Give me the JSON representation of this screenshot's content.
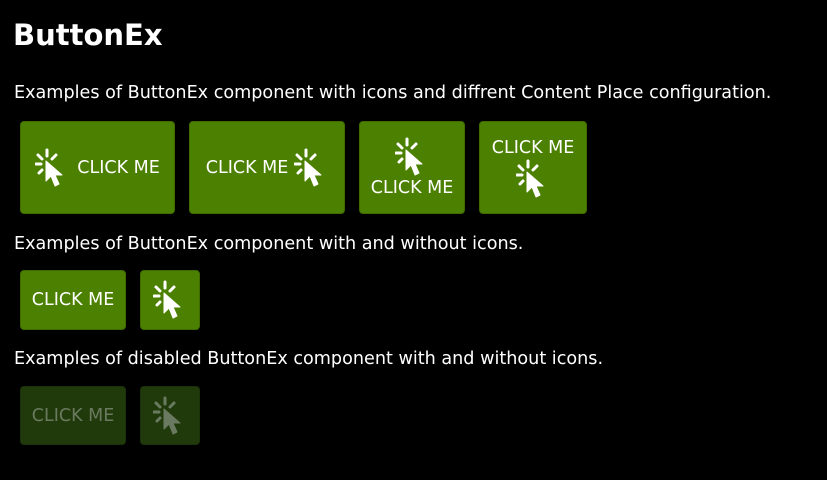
{
  "page": {
    "title": "ButtonEx",
    "desc_icons_places": "Examples of ButtonEx component with icons and diffrent Content Place configuration.",
    "desc_with_without": "Examples of ButtonEx component with and without icons.",
    "desc_disabled": "Examples of disabled ButtonEx component with and without icons."
  },
  "buttons": {
    "icon_left": {
      "label": "CLICK ME",
      "icon": "click-pointer-icon"
    },
    "icon_right": {
      "label": "CLICK ME",
      "icon": "click-pointer-icon"
    },
    "icon_top": {
      "label": "CLICK ME",
      "icon": "click-pointer-icon"
    },
    "icon_bottom": {
      "label": "CLICK ME",
      "icon": "click-pointer-icon"
    },
    "text_only": {
      "label": "CLICK ME"
    },
    "icon_only": {
      "icon": "click-pointer-icon"
    },
    "disabled_text_only": {
      "label": "CLICK ME"
    },
    "disabled_icon_only": {
      "icon": "click-pointer-icon"
    }
  },
  "colors": {
    "background": "#000000",
    "button": "#4c8000",
    "button_disabled": "#213a0b",
    "text": "#ffffff",
    "text_disabled": "#6a7a60"
  }
}
